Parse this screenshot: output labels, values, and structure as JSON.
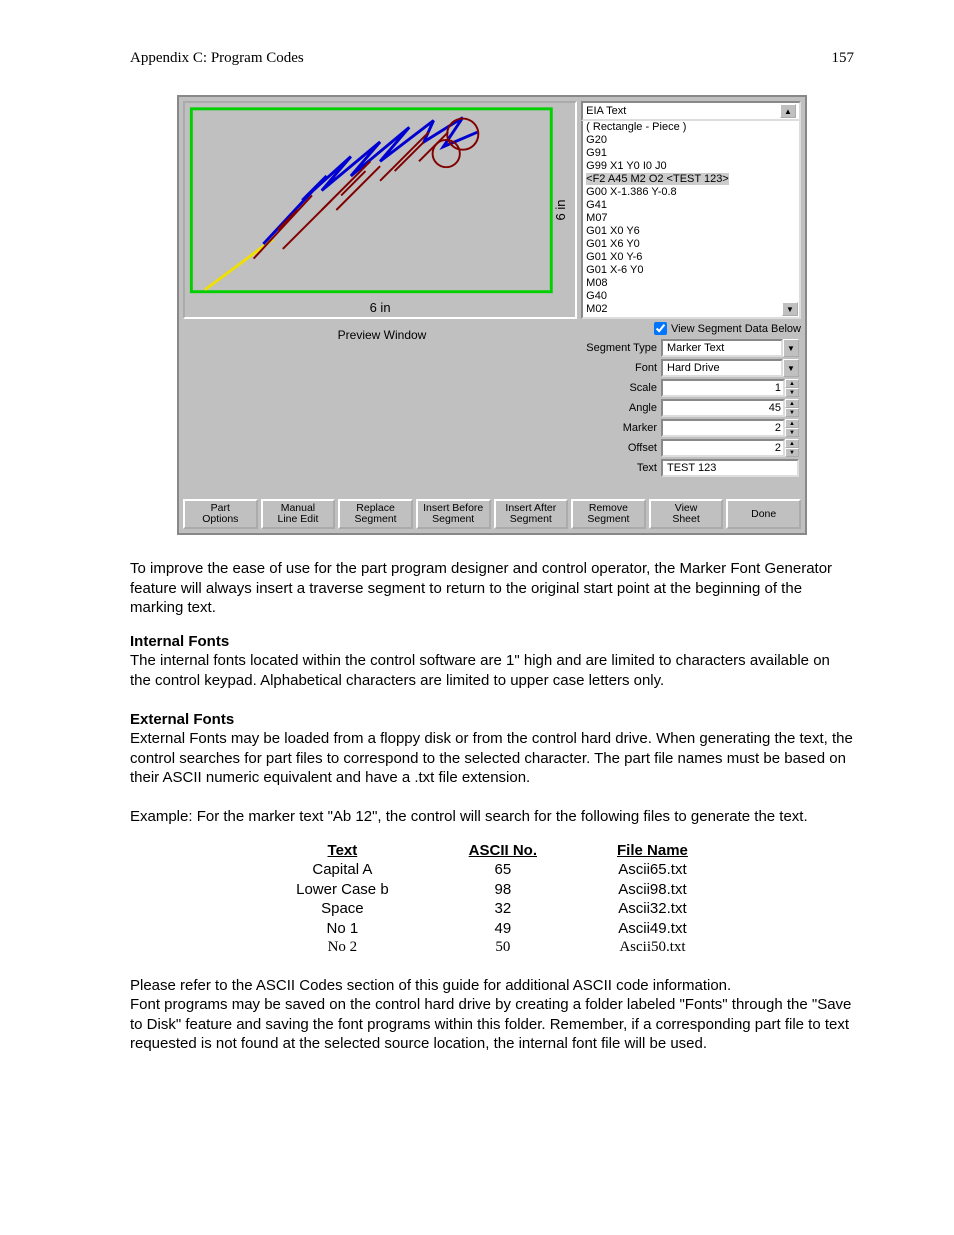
{
  "header": {
    "left": "Appendix C: Program Codes",
    "right": "157"
  },
  "preview": {
    "dim_x": "6 in",
    "dim_y": "6 in",
    "footer": "Preview Window"
  },
  "eia": {
    "title": "EIA Text",
    "lines_pre": "( Rectangle - Piece )\nG20\nG91\nG99 X1 Y0 I0 J0\n",
    "lines_hl": "<F2 A45 M2 O2 <TEST 123>",
    "lines_post": "\nG00 X-1.386 Y-0.8\nG41\nM07\nG01 X0 Y6\nG01 X6 Y0\nG01 X0 Y-6\nG01 X-6 Y0\nM08\nG40\nM02"
  },
  "view_check_label": "View Segment Data Below",
  "form": {
    "segment_type": {
      "label": "Segment Type",
      "value": "Marker Text"
    },
    "font": {
      "label": "Font",
      "value": "Hard Drive"
    },
    "scale": {
      "label": "Scale",
      "value": "1"
    },
    "angle": {
      "label": "Angle",
      "value": "45"
    },
    "marker": {
      "label": "Marker",
      "value": "2"
    },
    "offset": {
      "label": "Offset",
      "value": "2"
    },
    "text": {
      "label": "Text",
      "value": "TEST 123"
    }
  },
  "buttons": {
    "b0": "Part\nOptions",
    "b1": "Manual\nLine Edit",
    "b2": "Replace\nSegment",
    "b3": "Insert Before\nSegment",
    "b4": "Insert After\nSegment",
    "b5": "Remove\nSegment",
    "b6": "View\nSheet",
    "b7": "Done"
  },
  "body": {
    "p1": "To improve the ease of use for the part program designer and control operator, the Marker Font Generator feature will always insert a traverse segment to return to the original start point at the beginning of the marking text.",
    "h_internal": "Internal Fonts",
    "p2": "The internal fonts located within the control software are 1\" high and are limited to characters available on the control keypad.  Alphabetical characters are limited to upper case letters only.",
    "h_external": "External Fonts",
    "p3": "External Fonts may be loaded from a floppy disk or from the control hard drive.  When generating the text, the control searches for part files to correspond to the selected character.  The part file names must be based on their ASCII numeric equivalent and have a .txt file extension.",
    "p4": "Example:  For the marker text \"Ab 12\", the control will search for the following files to generate the text.",
    "table": {
      "h0": "Text",
      "h1": "ASCII No.",
      "h2": "File Name",
      "r0": {
        "c0": "Capital A",
        "c1": "65",
        "c2": "Ascii65.txt"
      },
      "r1": {
        "c0": "Lower Case b",
        "c1": "98",
        "c2": "Ascii98.txt"
      },
      "r2": {
        "c0": "Space",
        "c1": "32",
        "c2": "Ascii32.txt"
      },
      "r3": {
        "c0": "No 1",
        "c1": "49",
        "c2": "Ascii49.txt"
      },
      "r4": {
        "c0": "No 2",
        "c1": "50",
        "c2": "Ascii50.txt"
      }
    },
    "p5": "Please refer to the ASCII Codes section of this guide for additional ASCII code information.",
    "p6": "Font programs may be saved on the control hard drive by creating a folder labeled \"Fonts\" through the \"Save to Disk\" feature and saving the font programs within this folder.  Remember, if a corresponding part file to text requested is not found at the selected source location, the internal font file will be used."
  }
}
